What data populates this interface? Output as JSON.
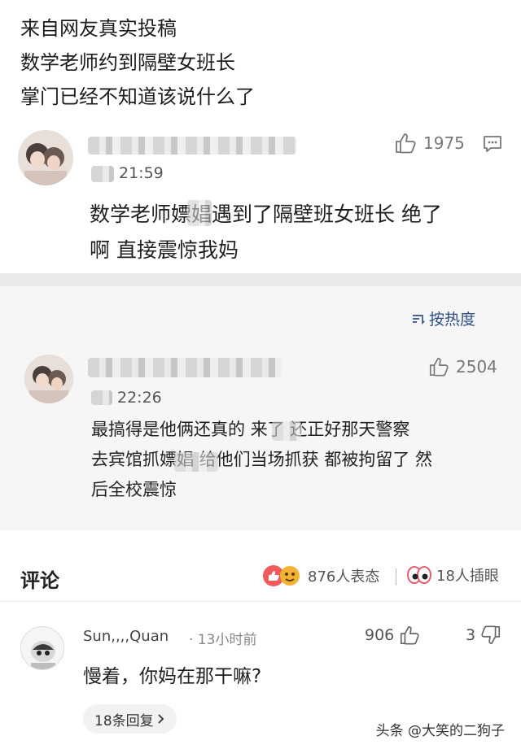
{
  "intro": {
    "line1": "来自网友真实投稿",
    "line2": "数学老师约到隔壁女班长",
    "line3": "掌门已经不知道该说什么了"
  },
  "post1": {
    "time": "21:59",
    "likes": "1975",
    "text_line1": "数学老师嫖娼遇到了隔壁班女班长 绝了",
    "text_line2": "啊 直接震惊我妈"
  },
  "sort": {
    "label": "按热度"
  },
  "post2": {
    "time": "22:26",
    "likes": "2504",
    "text_line1": "最搞得是他俩还真的 来了 还正好那天警察",
    "text_line2": "去宾馆抓嫖娼 给他们当场抓获 都被拘留了 然",
    "text_line3": "后全校震惊"
  },
  "comments_header": {
    "title": "评论",
    "reactions": "876人表态",
    "pinned": "18人插眼"
  },
  "comment": {
    "user": "Sun,,,,Quan",
    "time": "· 13小时前",
    "likes": "906",
    "replies_count": "3",
    "text": "慢着，你妈在那干嘛?",
    "replies_button": "18条回复"
  },
  "watermark": "头条 @大笑的二狗子",
  "colors": {
    "link_blue": "#2d4f86",
    "separator": "#e9e9e9",
    "card_bg": "#f6f6f6"
  }
}
